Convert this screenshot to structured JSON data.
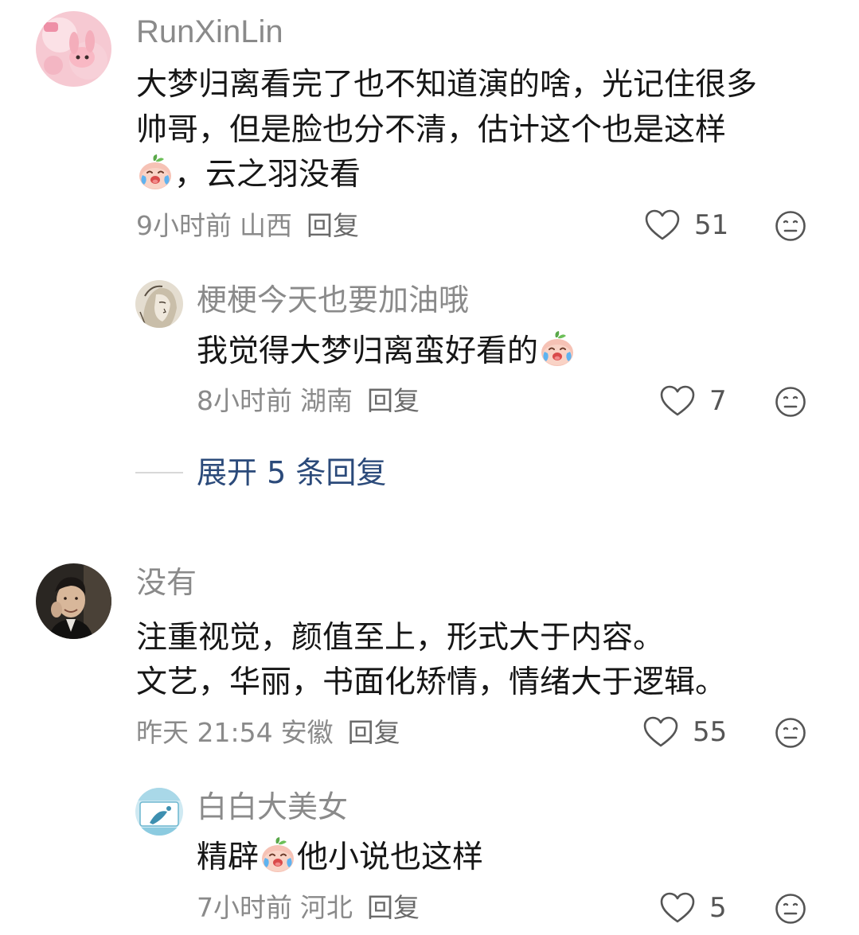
{
  "comments": [
    {
      "username": "RunXinLin",
      "lines": [
        "大梦归离看完了也不知道演的啥，光记住很多",
        "帅哥，但是脸也分不清，估计这个也是这样",
        "，云之羽没看"
      ],
      "time": "9小时前",
      "location": "山西",
      "reply_label": "回复",
      "likes": "51",
      "avatar_icon": "pink-bunny-avatar",
      "emoji_icon": "crying-peach-emoji"
    },
    {
      "username": "梗梗今天也要加油哦",
      "text": "我觉得大梦归离蛮好看的",
      "time": "8小时前",
      "location": "湖南",
      "reply_label": "回复",
      "likes": "7",
      "avatar_icon": "sketch-portrait-avatar",
      "emoji_icon": "crying-peach-emoji"
    },
    {
      "username": "没有",
      "lines": [
        "注重视觉，颜值至上，形式大于内容。",
        "文艺，华丽，书面化矫情，情绪大于逻辑。"
      ],
      "time": "昨天 21:54",
      "location": "安徽",
      "reply_label": "回复",
      "likes": "55",
      "avatar_icon": "man-portrait-avatar"
    },
    {
      "username": "白白大美女",
      "text_before": "精辟",
      "text_after": "他小说也这样",
      "time": "7小时前",
      "location": "河北",
      "reply_label": "回复",
      "likes": "5",
      "avatar_icon": "blue-scene-avatar",
      "emoji_icon": "crying-peach-emoji"
    }
  ],
  "expand_replies": "展开 5 条回复",
  "colors": {
    "username": "#8a8a8a",
    "text": "#161616",
    "meta": "#8a8a8a",
    "expand": "#2b4a7a"
  }
}
